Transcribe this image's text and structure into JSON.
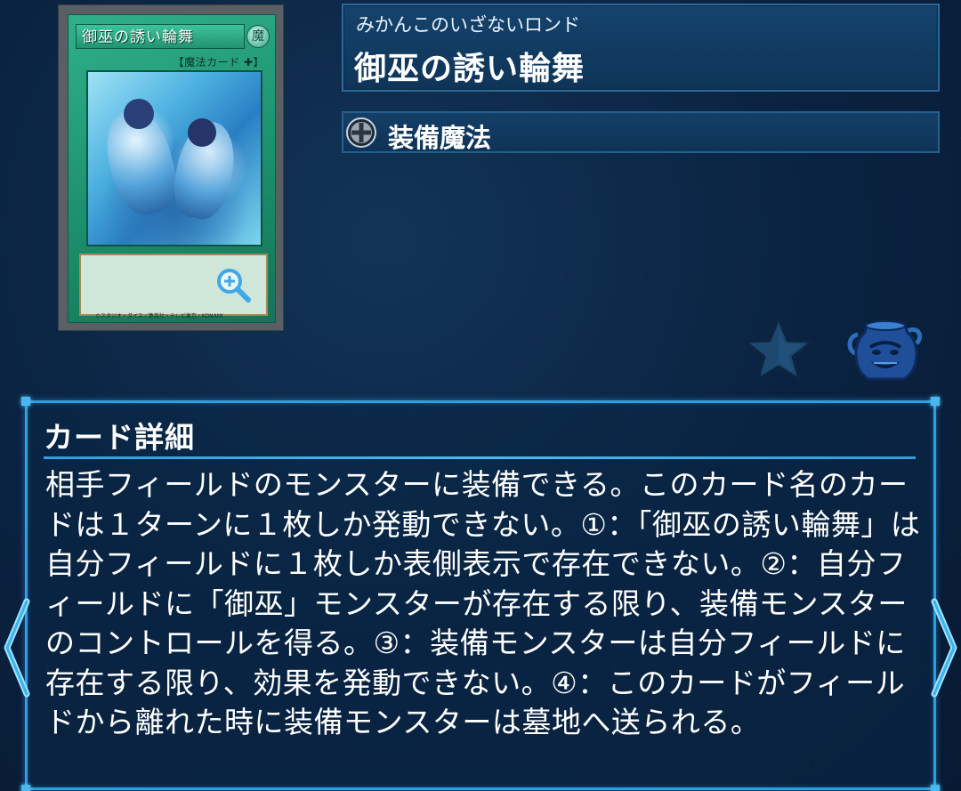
{
  "card": {
    "art_title": "御巫の誘い輪舞",
    "art_type_line": "【魔法カード ✚】",
    "footer_text": "©スタジオ・ダイス／集英社・テレビ東京・KONAMI"
  },
  "header": {
    "ruby": "みかんこのいざないロンド",
    "name": "御巫の誘い輪舞"
  },
  "type": {
    "icon": "equip-spell-icon",
    "label": "装備魔法"
  },
  "actions": {
    "favorite_icon": "star-icon",
    "deck_icon": "pot-of-greed-icon"
  },
  "detail": {
    "title": "カード詳細",
    "text": "相手フィールドのモンスターに装備できる。このカード名のカードは１ターンに１枚しか発動できない。①：「御巫の誘い輪舞」は自分フィールドに１枚しか表側表示で存在できない。②：自分フィールドに「御巫」モンスターが存在する限り、装備モンスターのコントロールを得る。③：装備モンスターは自分フィールドに存在する限り、効果を発動できない。④：このカードがフィールドから離れた時に装備モンスターは墓地へ送られる。"
  },
  "nav": {
    "prev_icon": "chevron-left-icon",
    "next_icon": "chevron-right-icon"
  },
  "colors": {
    "panel_border": "#2c9fe0",
    "spell_green": "#1b8d6a",
    "background": "#0b2340"
  }
}
